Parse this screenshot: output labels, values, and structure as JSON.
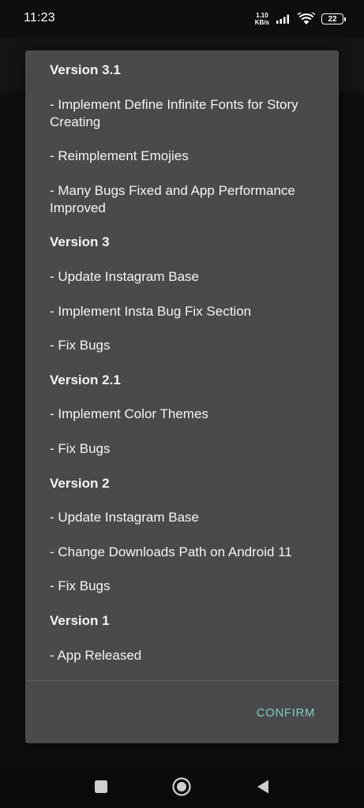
{
  "status_bar": {
    "time": "11:23",
    "net_speed_value": "1.10",
    "net_speed_unit": "KB/s",
    "battery_level": "22",
    "icons": [
      "signal-icon",
      "wifi-icon",
      "battery-icon"
    ]
  },
  "dialog": {
    "lines": [
      {
        "text": "Version 3.1",
        "heading": true
      },
      {
        "text": "- Implement Define Infinite Fonts for Story Creating",
        "heading": false
      },
      {
        "text": "- Reimplement Emojies",
        "heading": false
      },
      {
        "text": "- Many Bugs Fixed and App Performance Improved",
        "heading": false
      },
      {
        "text": "Version 3",
        "heading": true
      },
      {
        "text": "- Update Instagram Base",
        "heading": false
      },
      {
        "text": "- Implement Insta Bug Fix Section",
        "heading": false
      },
      {
        "text": "- Fix Bugs",
        "heading": false
      },
      {
        "text": "Version 2.1",
        "heading": true
      },
      {
        "text": "- Implement Color Themes",
        "heading": false
      },
      {
        "text": "- Fix Bugs",
        "heading": false
      },
      {
        "text": "Version 2",
        "heading": true
      },
      {
        "text": "- Update Instagram Base",
        "heading": false
      },
      {
        "text": "- Change Downloads Path on Android 11",
        "heading": false
      },
      {
        "text": "- Fix Bugs",
        "heading": false
      },
      {
        "text": "Version 1",
        "heading": true
      },
      {
        "text": "- App Released",
        "heading": false
      }
    ],
    "confirm_label": "CONFIRM"
  },
  "nav_bar": {
    "buttons": [
      "recents-icon",
      "home-icon",
      "back-icon"
    ]
  },
  "colors": {
    "dialog_background": "#4a4a4a",
    "accent": "#80cbc4",
    "screen_background": "#0e0e0e"
  }
}
